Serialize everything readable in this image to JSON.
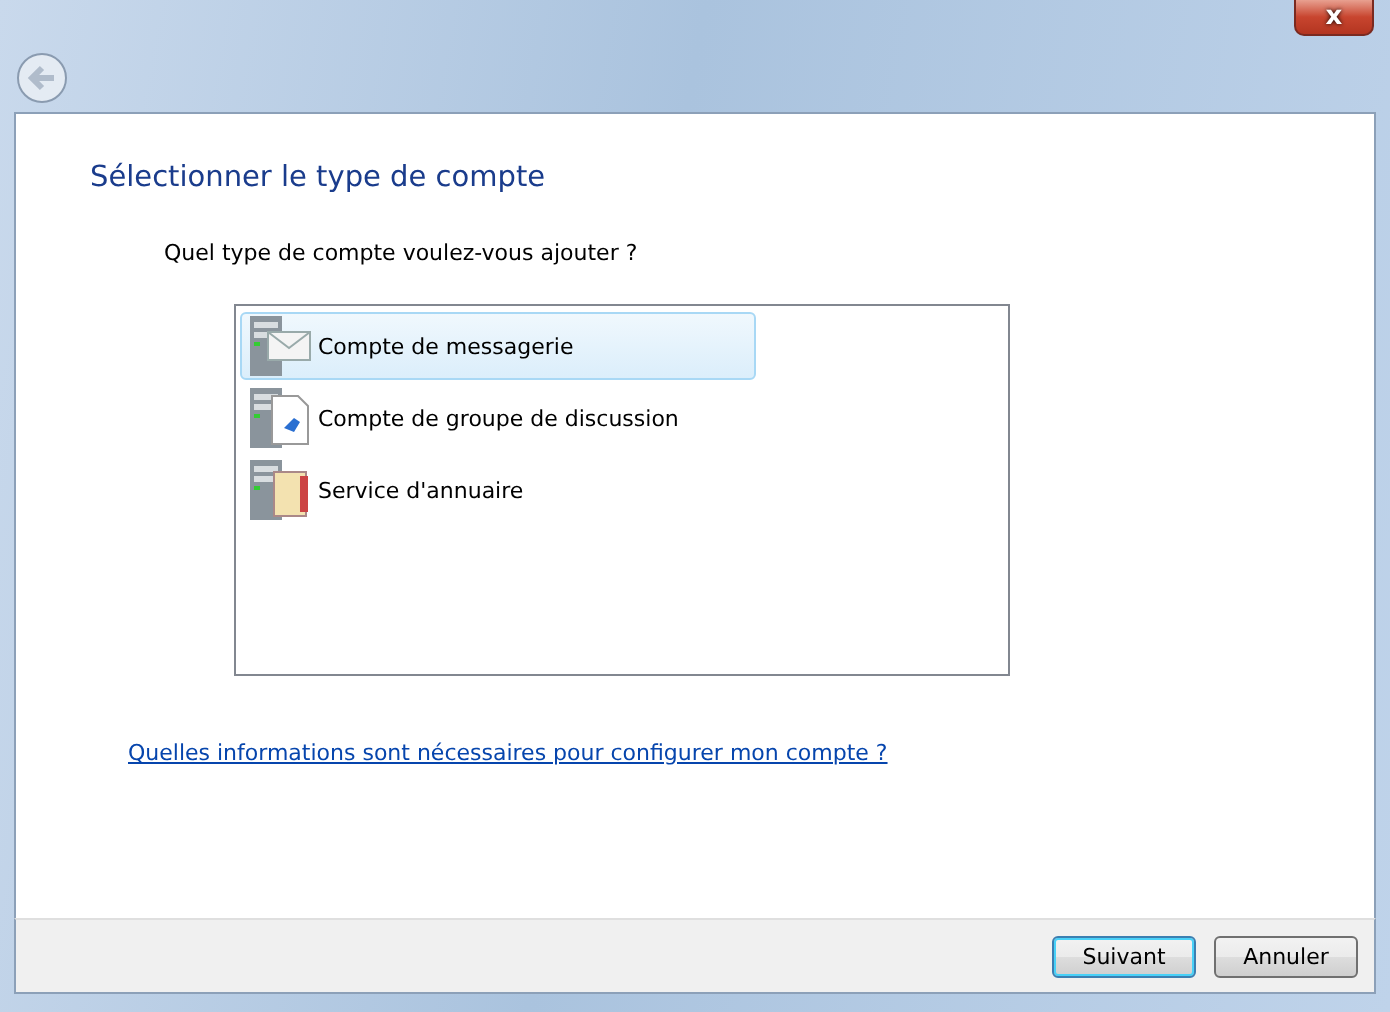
{
  "window": {
    "close": "x"
  },
  "page": {
    "title": "Sélectionner le type de compte",
    "question": "Quel type de compte voulez-vous ajouter ?",
    "accounts": [
      {
        "kind": "email",
        "label": "Compte de messagerie",
        "selected": true
      },
      {
        "kind": "newsgroup",
        "label": "Compte de groupe de discussion",
        "selected": false
      },
      {
        "kind": "directory",
        "label": "Service d'annuaire",
        "selected": false
      }
    ],
    "help_link": "Quelles informations sont nécessaires pour configurer mon compte ?"
  },
  "buttons": [
    {
      "label": "Suivant",
      "default": true
    },
    {
      "label": "Annuler",
      "default": false
    }
  ]
}
